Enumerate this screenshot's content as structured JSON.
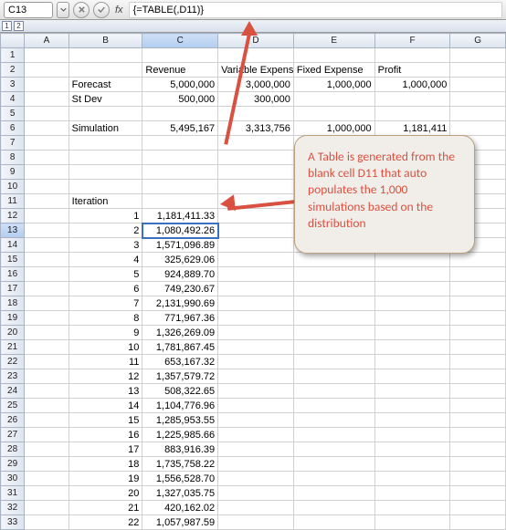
{
  "nameBox": "C13",
  "formula": "{=TABLE(,D11)}",
  "outline": {
    "b1": "1",
    "b2": "2"
  },
  "columns": [
    "",
    "A",
    "B",
    "C",
    "D",
    "E",
    "F",
    "G"
  ],
  "headerRow": {
    "c": "Revenue",
    "d": "Variable Expense",
    "e": "Fixed Expense",
    "f": "Profit"
  },
  "row3": {
    "b": "Forecast",
    "c": "5,000,000",
    "d": "3,000,000",
    "e": "1,000,000",
    "f": "1,000,000"
  },
  "row4": {
    "b": "St Dev",
    "c": "500,000",
    "d": "300,000"
  },
  "row6": {
    "b": "Simulation",
    "c": "5,495,167",
    "d": "3,313,756",
    "e": "1,000,000",
    "f": "1,181,411"
  },
  "row11": {
    "b": "Iteration"
  },
  "iterations": [
    {
      "n": "1",
      "v": "1,181,411.33"
    },
    {
      "n": "2",
      "v": "1,080,492.26"
    },
    {
      "n": "3",
      "v": "1,571,096.89"
    },
    {
      "n": "4",
      "v": "325,629.06"
    },
    {
      "n": "5",
      "v": "924,889.70"
    },
    {
      "n": "6",
      "v": "749,230.67"
    },
    {
      "n": "7",
      "v": "2,131,990.69"
    },
    {
      "n": "8",
      "v": "771,967.36"
    },
    {
      "n": "9",
      "v": "1,326,269.09"
    },
    {
      "n": "10",
      "v": "1,781,867.45"
    },
    {
      "n": "11",
      "v": "653,167.32"
    },
    {
      "n": "12",
      "v": "1,357,579.72"
    },
    {
      "n": "13",
      "v": "508,322.65"
    },
    {
      "n": "14",
      "v": "1,104,776.96"
    },
    {
      "n": "15",
      "v": "1,285,953.55"
    },
    {
      "n": "16",
      "v": "1,225,985.66"
    },
    {
      "n": "17",
      "v": "883,916.39"
    },
    {
      "n": "18",
      "v": "1,735,758.22"
    },
    {
      "n": "19",
      "v": "1,556,528.70"
    },
    {
      "n": "20",
      "v": "1,327,035.75"
    },
    {
      "n": "21",
      "v": "420,162.02"
    },
    {
      "n": "22",
      "v": "1,057,987.59"
    }
  ],
  "callout": "A Table is generated from the blank cell D11 that auto populates the 1,000 simulations based on the distribution",
  "selectedRowLabel": "13"
}
